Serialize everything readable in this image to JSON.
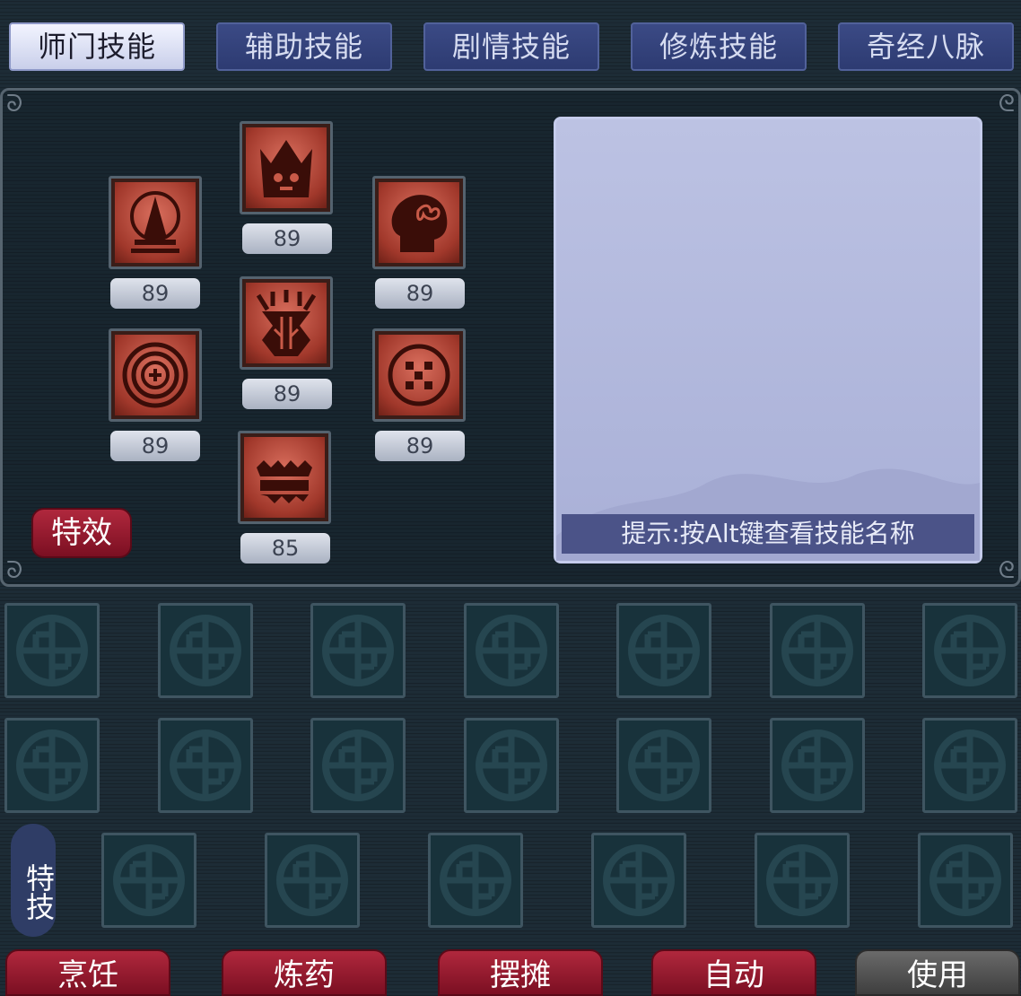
{
  "tabs": [
    {
      "label": "师门技能",
      "active": true
    },
    {
      "label": "辅助技能",
      "active": false
    },
    {
      "label": "剧情技能",
      "active": false
    },
    {
      "label": "修炼技能",
      "active": false
    },
    {
      "label": "奇经八脉",
      "active": false
    }
  ],
  "skills": [
    {
      "icon": "bell-icon",
      "level": "89"
    },
    {
      "icon": "crown-icon",
      "level": "89"
    },
    {
      "icon": "head-icon",
      "level": "89"
    },
    {
      "icon": "gear-icon",
      "level": "89"
    },
    {
      "icon": "totem-icon",
      "level": "89"
    },
    {
      "icon": "orb-icon",
      "level": "89"
    },
    {
      "icon": "flame-crown-icon",
      "level": "85"
    }
  ],
  "effects_button": "特效",
  "info_hint": "提示:按Alt键查看技能名称",
  "tech_label": "特技",
  "actions": [
    {
      "label": "烹饪",
      "enabled": true
    },
    {
      "label": "炼药",
      "enabled": true
    },
    {
      "label": "摆摊",
      "enabled": true
    },
    {
      "label": "自动",
      "enabled": true
    },
    {
      "label": "使用",
      "enabled": false
    }
  ],
  "colors": {
    "background": "#1d2c36",
    "tab": "#2d3b72",
    "tab_active": "#f2f4ff",
    "action_button": "#9a1f33",
    "skill_icon": "#c04a3a",
    "info_box": "#bcc2e3"
  }
}
